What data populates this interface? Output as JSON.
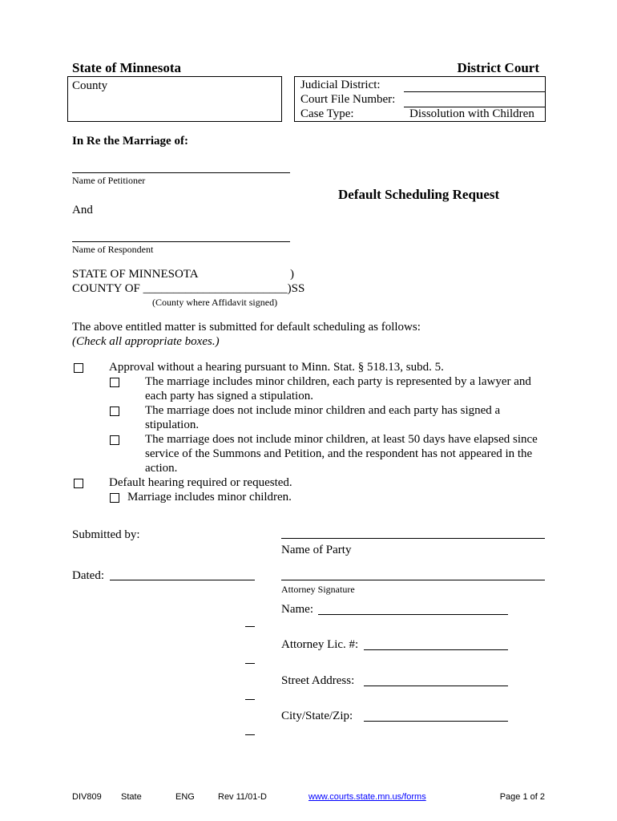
{
  "header": {
    "state": "State of Minnesota",
    "court": "District Court",
    "county_label": "County",
    "judicial_district_label": "Judicial District:",
    "court_file_number_label": "Court File Number:",
    "case_type_label": "Case Type:",
    "case_type_value": "Dissolution with Children"
  },
  "caption": {
    "in_re": "In Re the Marriage of:",
    "petitioner_label": "Name of Petitioner",
    "and": "And",
    "respondent_label": "Name of Respondent"
  },
  "title": "Default Scheduling Request",
  "venue": {
    "state": "STATE OF MINNESOTA",
    "paren": ")",
    "county": "COUNTY OF ________________________)SS",
    "county_note": "(County where Affidavit signed)"
  },
  "intro": {
    "line1": "The above entitled matter is submitted for default scheduling as follows:",
    "line2": "(Check all appropriate boxes.)"
  },
  "options": [
    {
      "text": "Approval without a hearing pursuant to Minn. Stat. § 518.13, subd. 5.",
      "checked": false,
      "sub": [
        {
          "lines": [
            "The marriage includes minor children, each party is represented by a lawyer and",
            "each party has signed a stipulation."
          ],
          "checked": false
        },
        {
          "lines": [
            "The marriage does not include minor children and each party has signed a",
            "stipulation."
          ],
          "checked": false
        },
        {
          "lines": [
            "The marriage does not include minor children, at least 50 days have elapsed since",
            "service of the Summons and Petition, and the respondent has not appeared in the",
            "action."
          ],
          "checked": false
        }
      ]
    },
    {
      "text": "Default hearing required or requested.",
      "checked": false,
      "sub": [
        {
          "lines": [
            "Marriage includes minor children."
          ],
          "checked": false
        }
      ]
    }
  ],
  "signature": {
    "submitted_by": "Submitted by:",
    "name_of_party": "Name of Party",
    "dated": "Dated:",
    "attorney_signature": "Attorney Signature",
    "name": "Name:",
    "attorney_lic": "Attorney Lic. #:",
    "street": "Street Address:",
    "city": "City/State/Zip:"
  },
  "footer": {
    "form": "DIV809",
    "state": "State",
    "lang": "ENG",
    "rev": "Rev 11/01-D",
    "link": "www.courts.state.mn.us/forms",
    "page": "Page 1 of 2"
  }
}
